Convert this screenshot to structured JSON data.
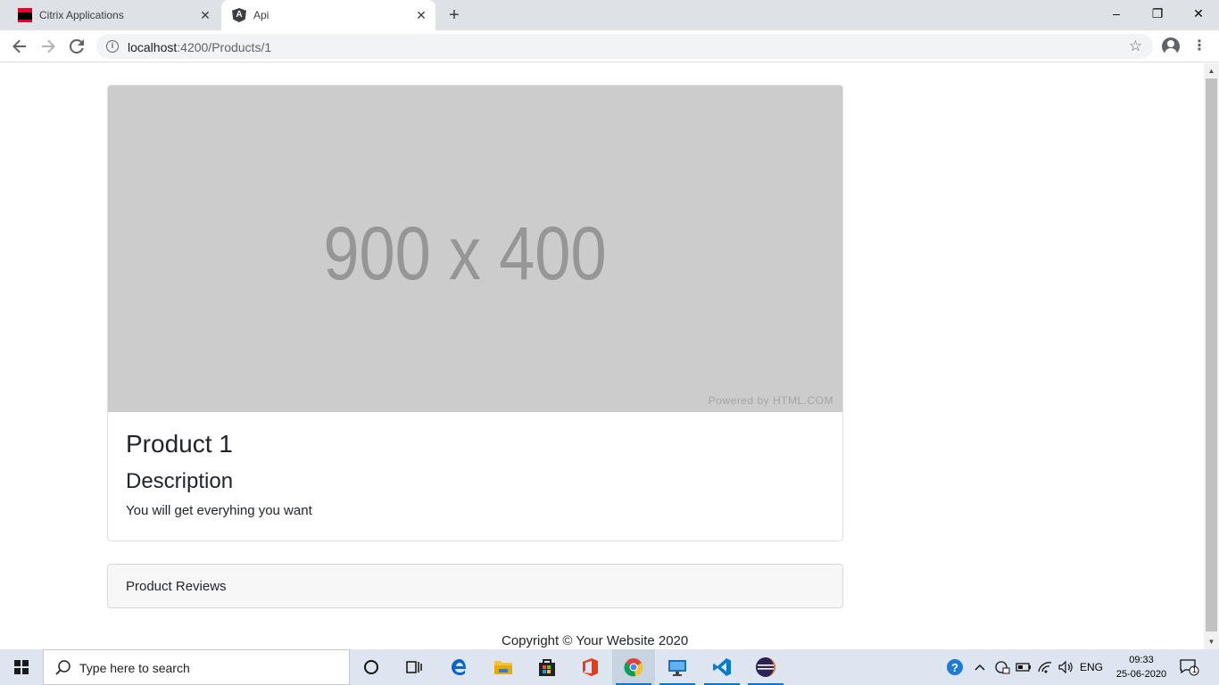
{
  "browser": {
    "tabs": [
      {
        "title": "Citrix Applications",
        "icon": "citrix-icon",
        "active": false
      },
      {
        "title": "Api",
        "icon": "angular-icon",
        "active": true
      }
    ],
    "url_host": "localhost",
    "url_path": ":4200/Products/1",
    "window_controls": {
      "minimize": "–",
      "restore": "❐",
      "close": "✕"
    }
  },
  "page": {
    "placeholder_text": "900 x 400",
    "placeholder_credit": "Powered by HTML.COM",
    "product_title": "Product 1",
    "description_heading": "Description",
    "description_text": "You will get everyhing you want",
    "reviews_label": "Product Reviews",
    "footer_text": "Copyright © Your Website 2020"
  },
  "taskbar": {
    "search_placeholder": "Type here to search",
    "pinned": [
      "cortana-icon",
      "task-view-icon",
      "edge-icon",
      "file-explorer-icon",
      "store-icon",
      "office-icon",
      "chrome-icon",
      "remote-desktop-icon",
      "vscode-icon",
      "eclipse-icon"
    ],
    "tray": {
      "language": "ENG",
      "time": "09:33",
      "date": "25-06-2020",
      "notification_count": "1"
    }
  },
  "colors": {
    "tabstrip": "#dee1e6",
    "placeholder_bg": "#cccccc",
    "placeholder_text": "#969696",
    "taskbar": "#dde6f0",
    "accent": "#0078d7"
  }
}
